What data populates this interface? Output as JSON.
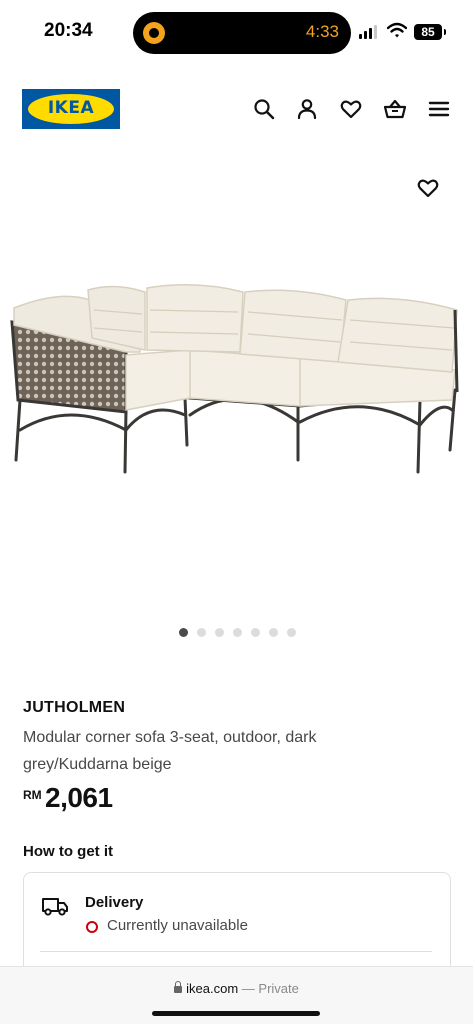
{
  "status_bar": {
    "time": "20:34",
    "timer": "4:33",
    "battery": "85",
    "icons": [
      "alarm-icon",
      "signal-icon",
      "wifi-icon",
      "battery-icon"
    ]
  },
  "header": {
    "logo_text": "IKEA",
    "icons": [
      "search-icon",
      "profile-icon",
      "heart-icon",
      "basket-icon",
      "menu-icon"
    ]
  },
  "product": {
    "image": "corner-sofa-image",
    "name": "JUTHOLMEN",
    "description": "Modular corner sofa 3-seat, outdoor, dark grey/Kuddarna beige",
    "price_currency": "RM",
    "price_value": "2,061",
    "carousel": {
      "total": 7,
      "active": 0
    }
  },
  "availability": {
    "title": "How to get it",
    "delivery_label": "Delivery",
    "delivery_status": "Currently unavailable"
  },
  "browser": {
    "domain": "ikea.com",
    "separator": "—",
    "mode": "Private"
  },
  "colors": {
    "ikea_blue": "#0058a3",
    "ikea_yellow": "#ffdb00",
    "unavailable_red": "#cc0008"
  }
}
